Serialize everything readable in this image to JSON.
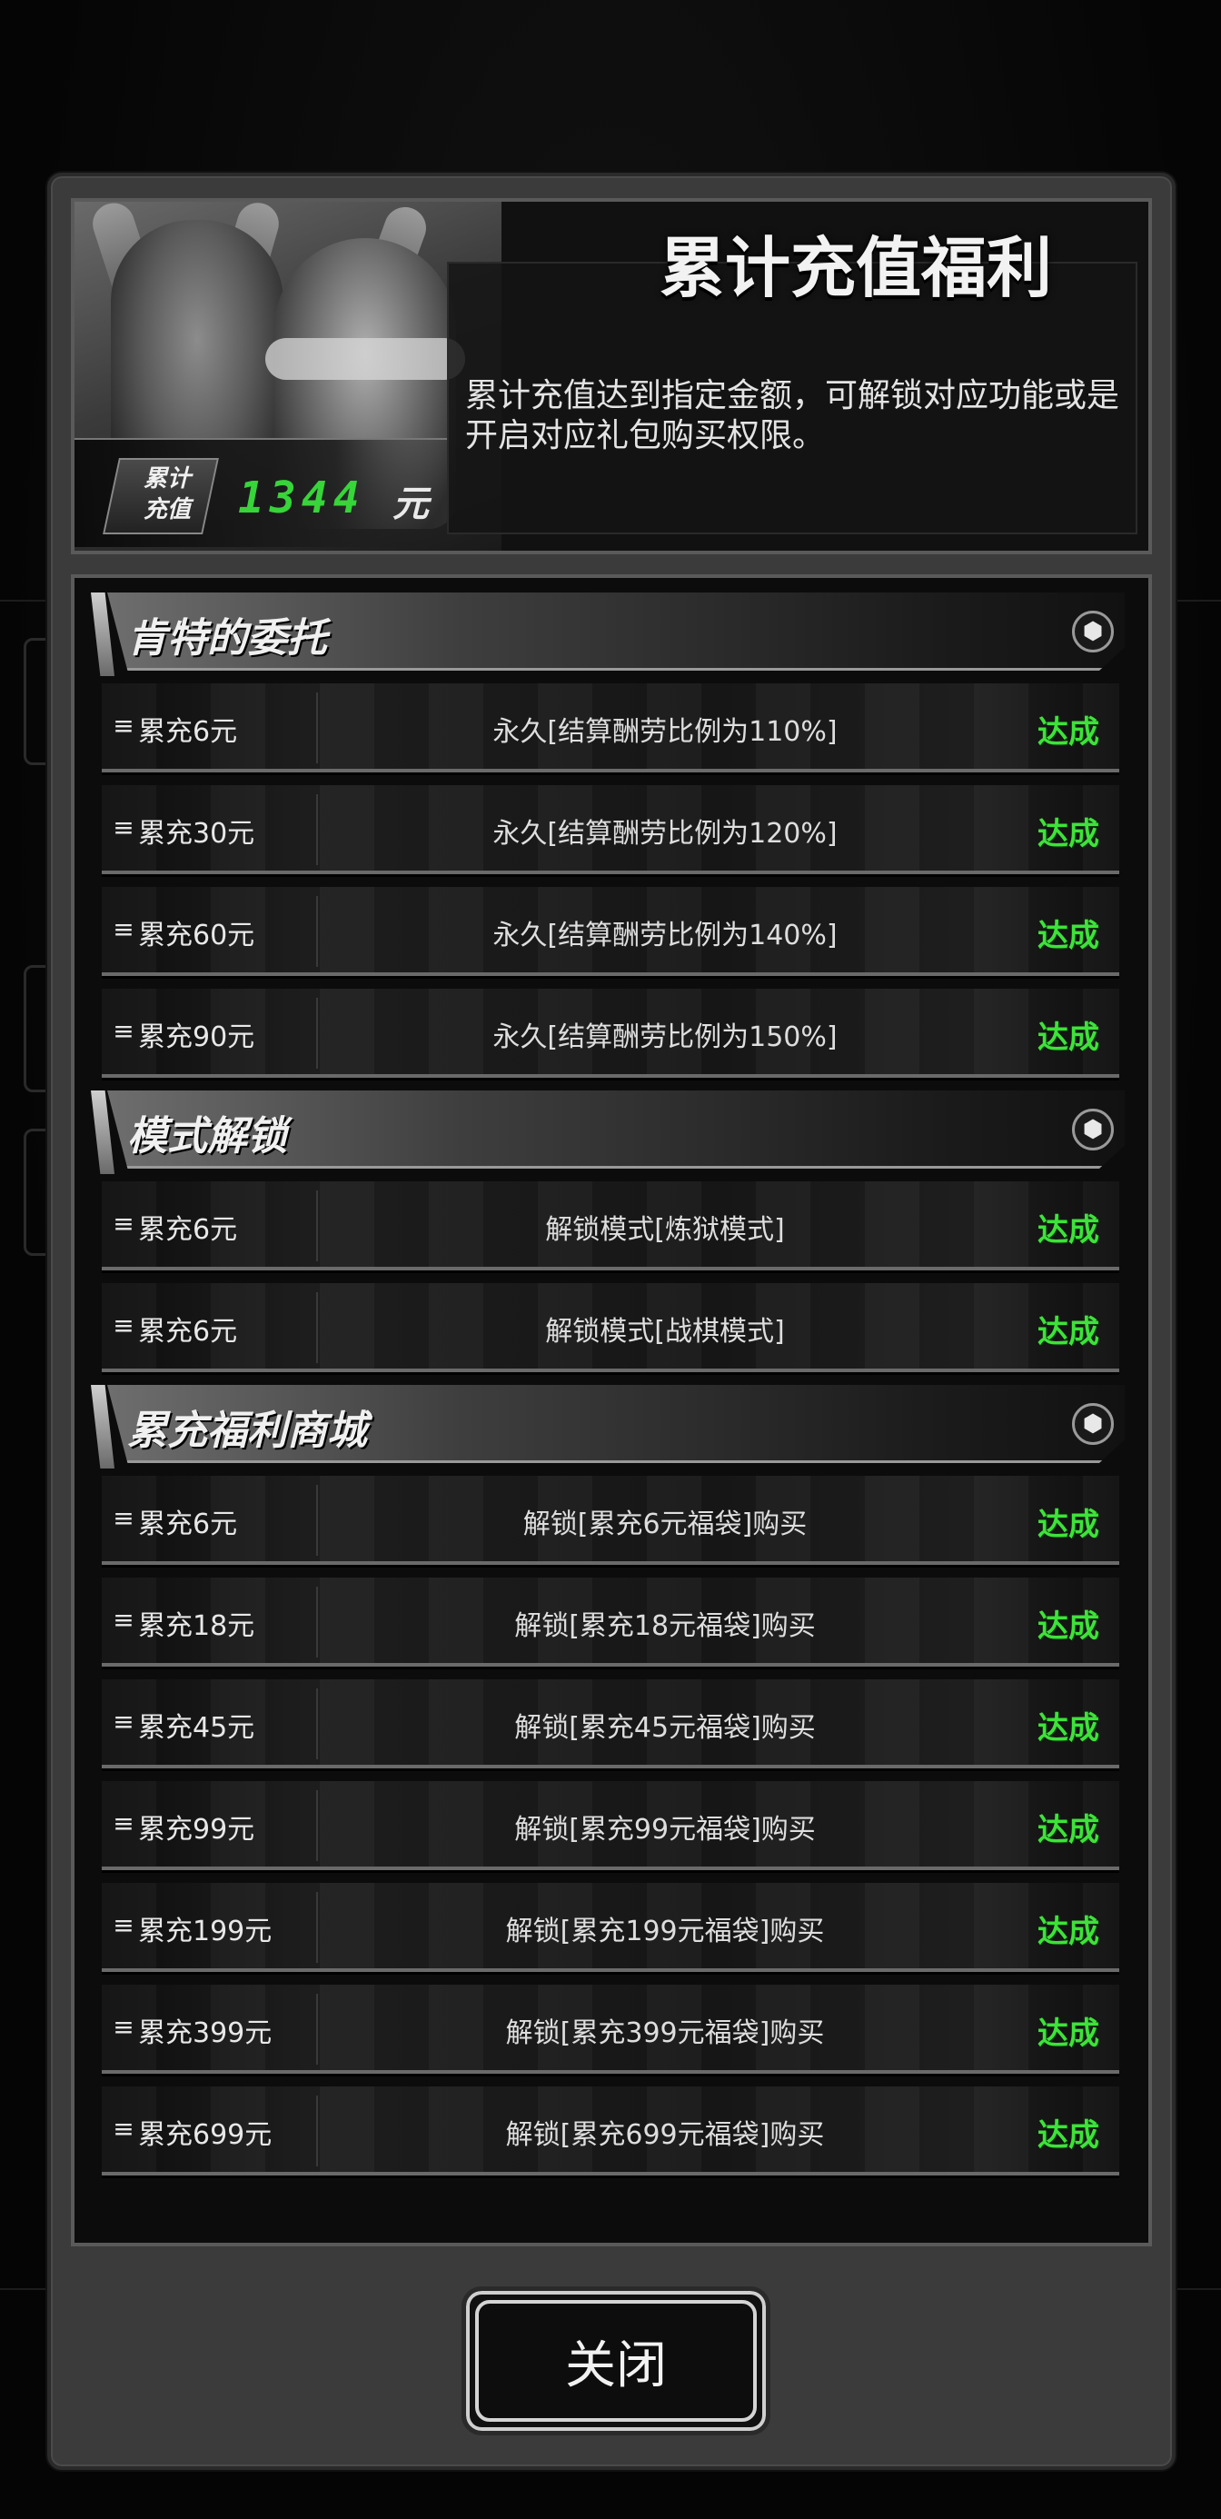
{
  "header": {
    "title": "累计充值福利",
    "description": "累计充值达到指定金额，可解锁对应功能或是开启对应礼包购买权限。",
    "total_label_line1": "累计",
    "total_label_line2": "充值",
    "total_amount": "1344",
    "total_unit": "元"
  },
  "sections": [
    {
      "title": "肯特的委托",
      "rows": [
        {
          "req": "累充6元",
          "reward": "永久[结算酬劳比例为110%]",
          "status": "达成"
        },
        {
          "req": "累充30元",
          "reward": "永久[结算酬劳比例为120%]",
          "status": "达成"
        },
        {
          "req": "累充60元",
          "reward": "永久[结算酬劳比例为140%]",
          "status": "达成"
        },
        {
          "req": "累充90元",
          "reward": "永久[结算酬劳比例为150%]",
          "status": "达成"
        }
      ]
    },
    {
      "title": "模式解锁",
      "rows": [
        {
          "req": "累充6元",
          "reward": "解锁模式[炼狱模式]",
          "status": "达成"
        },
        {
          "req": "累充6元",
          "reward": "解锁模式[战棋模式]",
          "status": "达成"
        }
      ]
    },
    {
      "title": "累充福利商城",
      "rows": [
        {
          "req": "累充6元",
          "reward": "解锁[累充6元福袋]购买",
          "status": "达成"
        },
        {
          "req": "累充18元",
          "reward": "解锁[累充18元福袋]购买",
          "status": "达成"
        },
        {
          "req": "累充45元",
          "reward": "解锁[累充45元福袋]购买",
          "status": "达成"
        },
        {
          "req": "累充99元",
          "reward": "解锁[累充99元福袋]购买",
          "status": "达成"
        },
        {
          "req": "累充199元",
          "reward": "解锁[累充199元福袋]购买",
          "status": "达成"
        },
        {
          "req": "累充399元",
          "reward": "解锁[累充399元福袋]购买",
          "status": "达成"
        },
        {
          "req": "累充699元",
          "reward": "解锁[累充699元福袋]购买",
          "status": "达成"
        }
      ]
    }
  ],
  "close_label": "关闭",
  "icons": {
    "row": "layers-icon",
    "section": "hexagon-icon"
  },
  "colors": {
    "status_green": "#3ee23a",
    "total_green": "#37d43a"
  }
}
